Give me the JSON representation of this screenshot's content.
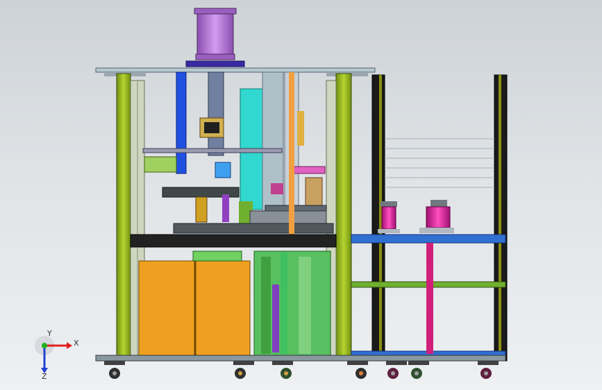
{
  "viewport": {
    "background": "#dfe3e6",
    "triad": {
      "x_label": "X",
      "y_label": "Y",
      "z_label": "Z",
      "x_color": "#e02020",
      "y_color": "#20b020",
      "z_color": "#2040d0"
    }
  },
  "palette": {
    "frame_green": "#9fc020",
    "orange_panel": "#f0a020",
    "cylinder_purple": "#b070d0",
    "spool_magenta": "#e020a0",
    "conveyor_blue": "#3070d0",
    "base_black": "#222222",
    "cyan_plate": "#30d8d0"
  }
}
